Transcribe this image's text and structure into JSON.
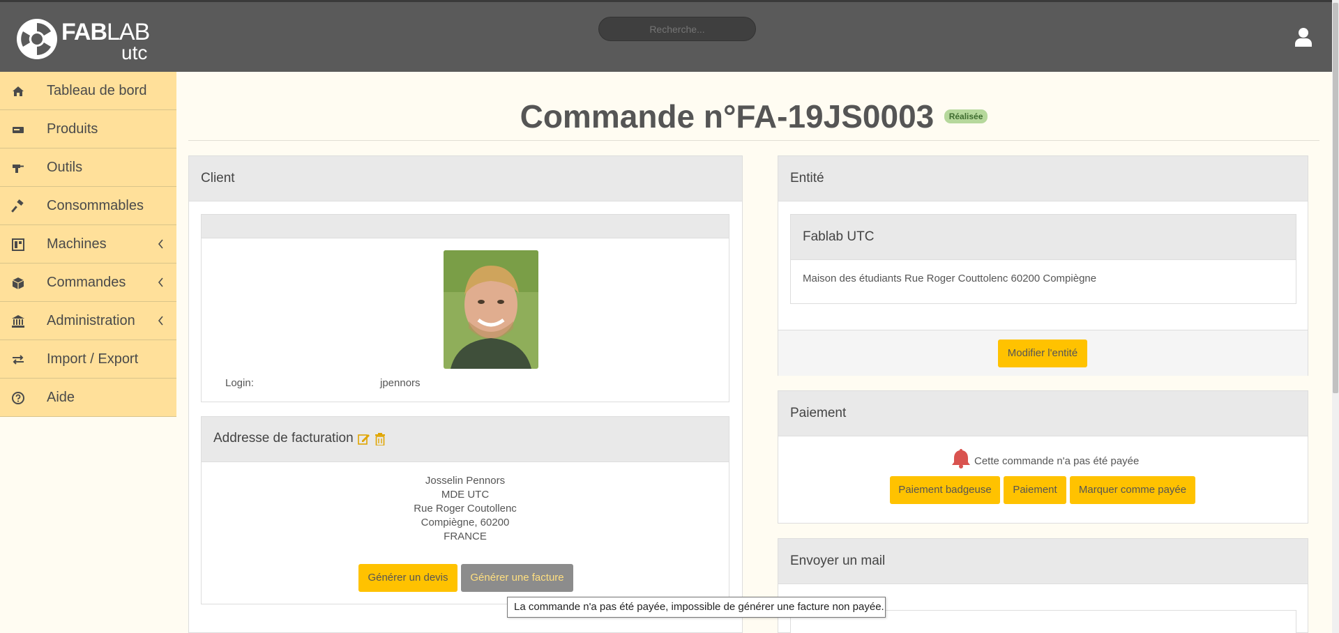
{
  "header": {
    "logo_fab": "FAB",
    "logo_lab": "LAB",
    "logo_sub": "utc",
    "search_placeholder": "Recherche...",
    "user_icon": "user-icon"
  },
  "sidebar": {
    "items": [
      {
        "label": "Tableau de bord",
        "icon": "home-icon",
        "has_submenu": false
      },
      {
        "label": "Produits",
        "icon": "products-icon",
        "has_submenu": false
      },
      {
        "label": "Outils",
        "icon": "drill-icon",
        "has_submenu": false
      },
      {
        "label": "Consommables",
        "icon": "hammer-icon",
        "has_submenu": false
      },
      {
        "label": "Machines",
        "icon": "machine-icon",
        "has_submenu": true
      },
      {
        "label": "Commandes",
        "icon": "box-icon",
        "has_submenu": true
      },
      {
        "label": "Administration",
        "icon": "bank-icon",
        "has_submenu": true
      },
      {
        "label": "Import / Export",
        "icon": "exchange-icon",
        "has_submenu": false
      },
      {
        "label": "Aide",
        "icon": "help-icon",
        "has_submenu": false
      }
    ]
  },
  "page": {
    "title": "Commande n°FA-19JS0003",
    "status_badge": "Réalisée"
  },
  "client": {
    "heading": "Client",
    "login_label": "Login:",
    "login_value": "jpennors",
    "billing_heading": "Addresse de facturation",
    "address_lines": [
      "Josselin Pennors",
      "MDE UTC",
      "Rue Roger Coutollenc",
      "Compiègne, 60200",
      "FRANCE"
    ],
    "btn_quote": "Générer un devis",
    "btn_invoice": "Générer une facture"
  },
  "entity": {
    "heading": "Entité",
    "name": "Fablab UTC",
    "address": "Maison des étudiants Rue Roger Couttolenc 60200 Compiègne",
    "btn_edit": "Modifier l'entité"
  },
  "payment": {
    "heading": "Paiement",
    "status_text": "Cette commande n'a pas été payée",
    "btn_badge": "Paiement badgeuse",
    "btn_pay": "Paiement",
    "btn_mark_paid": "Marquer comme payée"
  },
  "mail": {
    "heading": "Envoyer un mail"
  },
  "tooltip": {
    "text": "La commande n'a pas été payée, impossible de générer une facture non payée."
  },
  "colors": {
    "topbar": "#5a5a5a",
    "sidebar": "#ffe09a",
    "accent_button": "#ffc200",
    "disabled_button": "#8c8c8c",
    "badge_success": "#b6d89c",
    "bell": "#d9534f"
  }
}
